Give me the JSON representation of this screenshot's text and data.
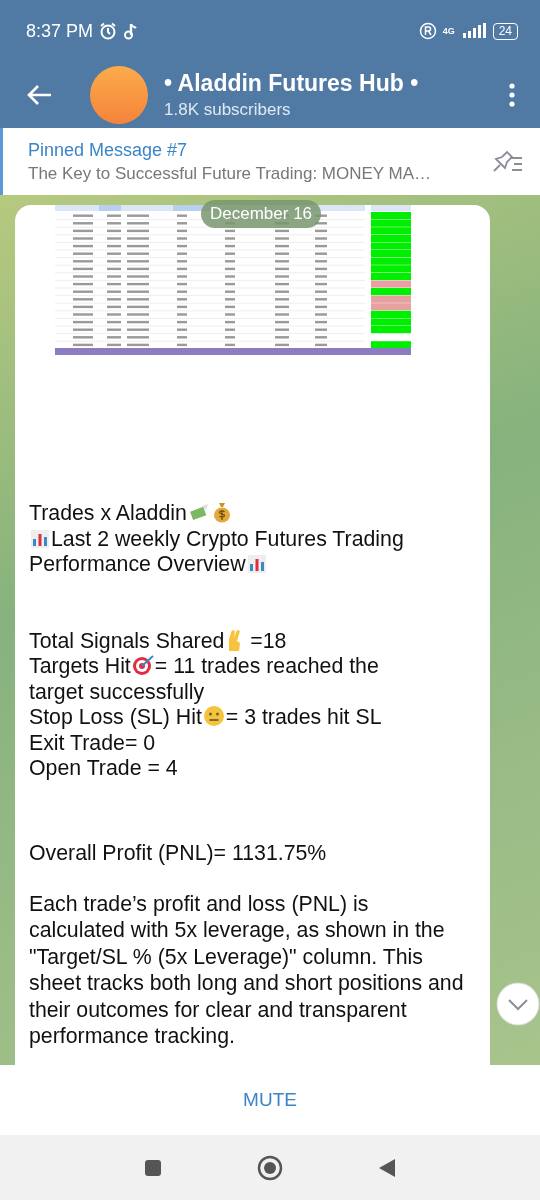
{
  "status_bar": {
    "time": "8:37 PM",
    "network": "4G",
    "battery": "24"
  },
  "header": {
    "title": "• Aladdin Futures Hub •",
    "subtitle": "1.8K subscribers"
  },
  "pinned": {
    "title": "Pinned Message #7",
    "text": "The Key to Successful Future Trading: MONEY MA…"
  },
  "date_chip": "December 16",
  "message": {
    "groups": [
      [
        {
          "text": "Trades x Aladdin"
        },
        {
          "text": "Last 2 weekly Crypto Futures Trading"
        },
        {
          "text": "Performance Overview"
        }
      ],
      [
        {
          "text": "Total Signals Shared",
          "after": " =18"
        },
        {
          "text": "Targets Hit",
          "after": "=  11  trades reached the"
        },
        {
          "text": "target successfully"
        },
        {
          "text": "Stop Loss (SL) Hit",
          "after": "=  3 trades hit SL"
        },
        {
          "text": "Exit Trade= 0"
        },
        {
          "text": "Open Trade = 4"
        }
      ],
      [
        {
          "text": "Overall Profit (PNL)=  1131.75%"
        }
      ],
      [
        {
          "text": "Each trade’s profit and loss (PNL) is calculated with 5x leverage, as shown in the \"Target/SL % (5x Leverage)\" column. This sheet tracks both long and short positions and their outcomes for clear and transparent performance tracking."
        }
      ]
    ]
  },
  "bottom_action": "MUTE"
}
